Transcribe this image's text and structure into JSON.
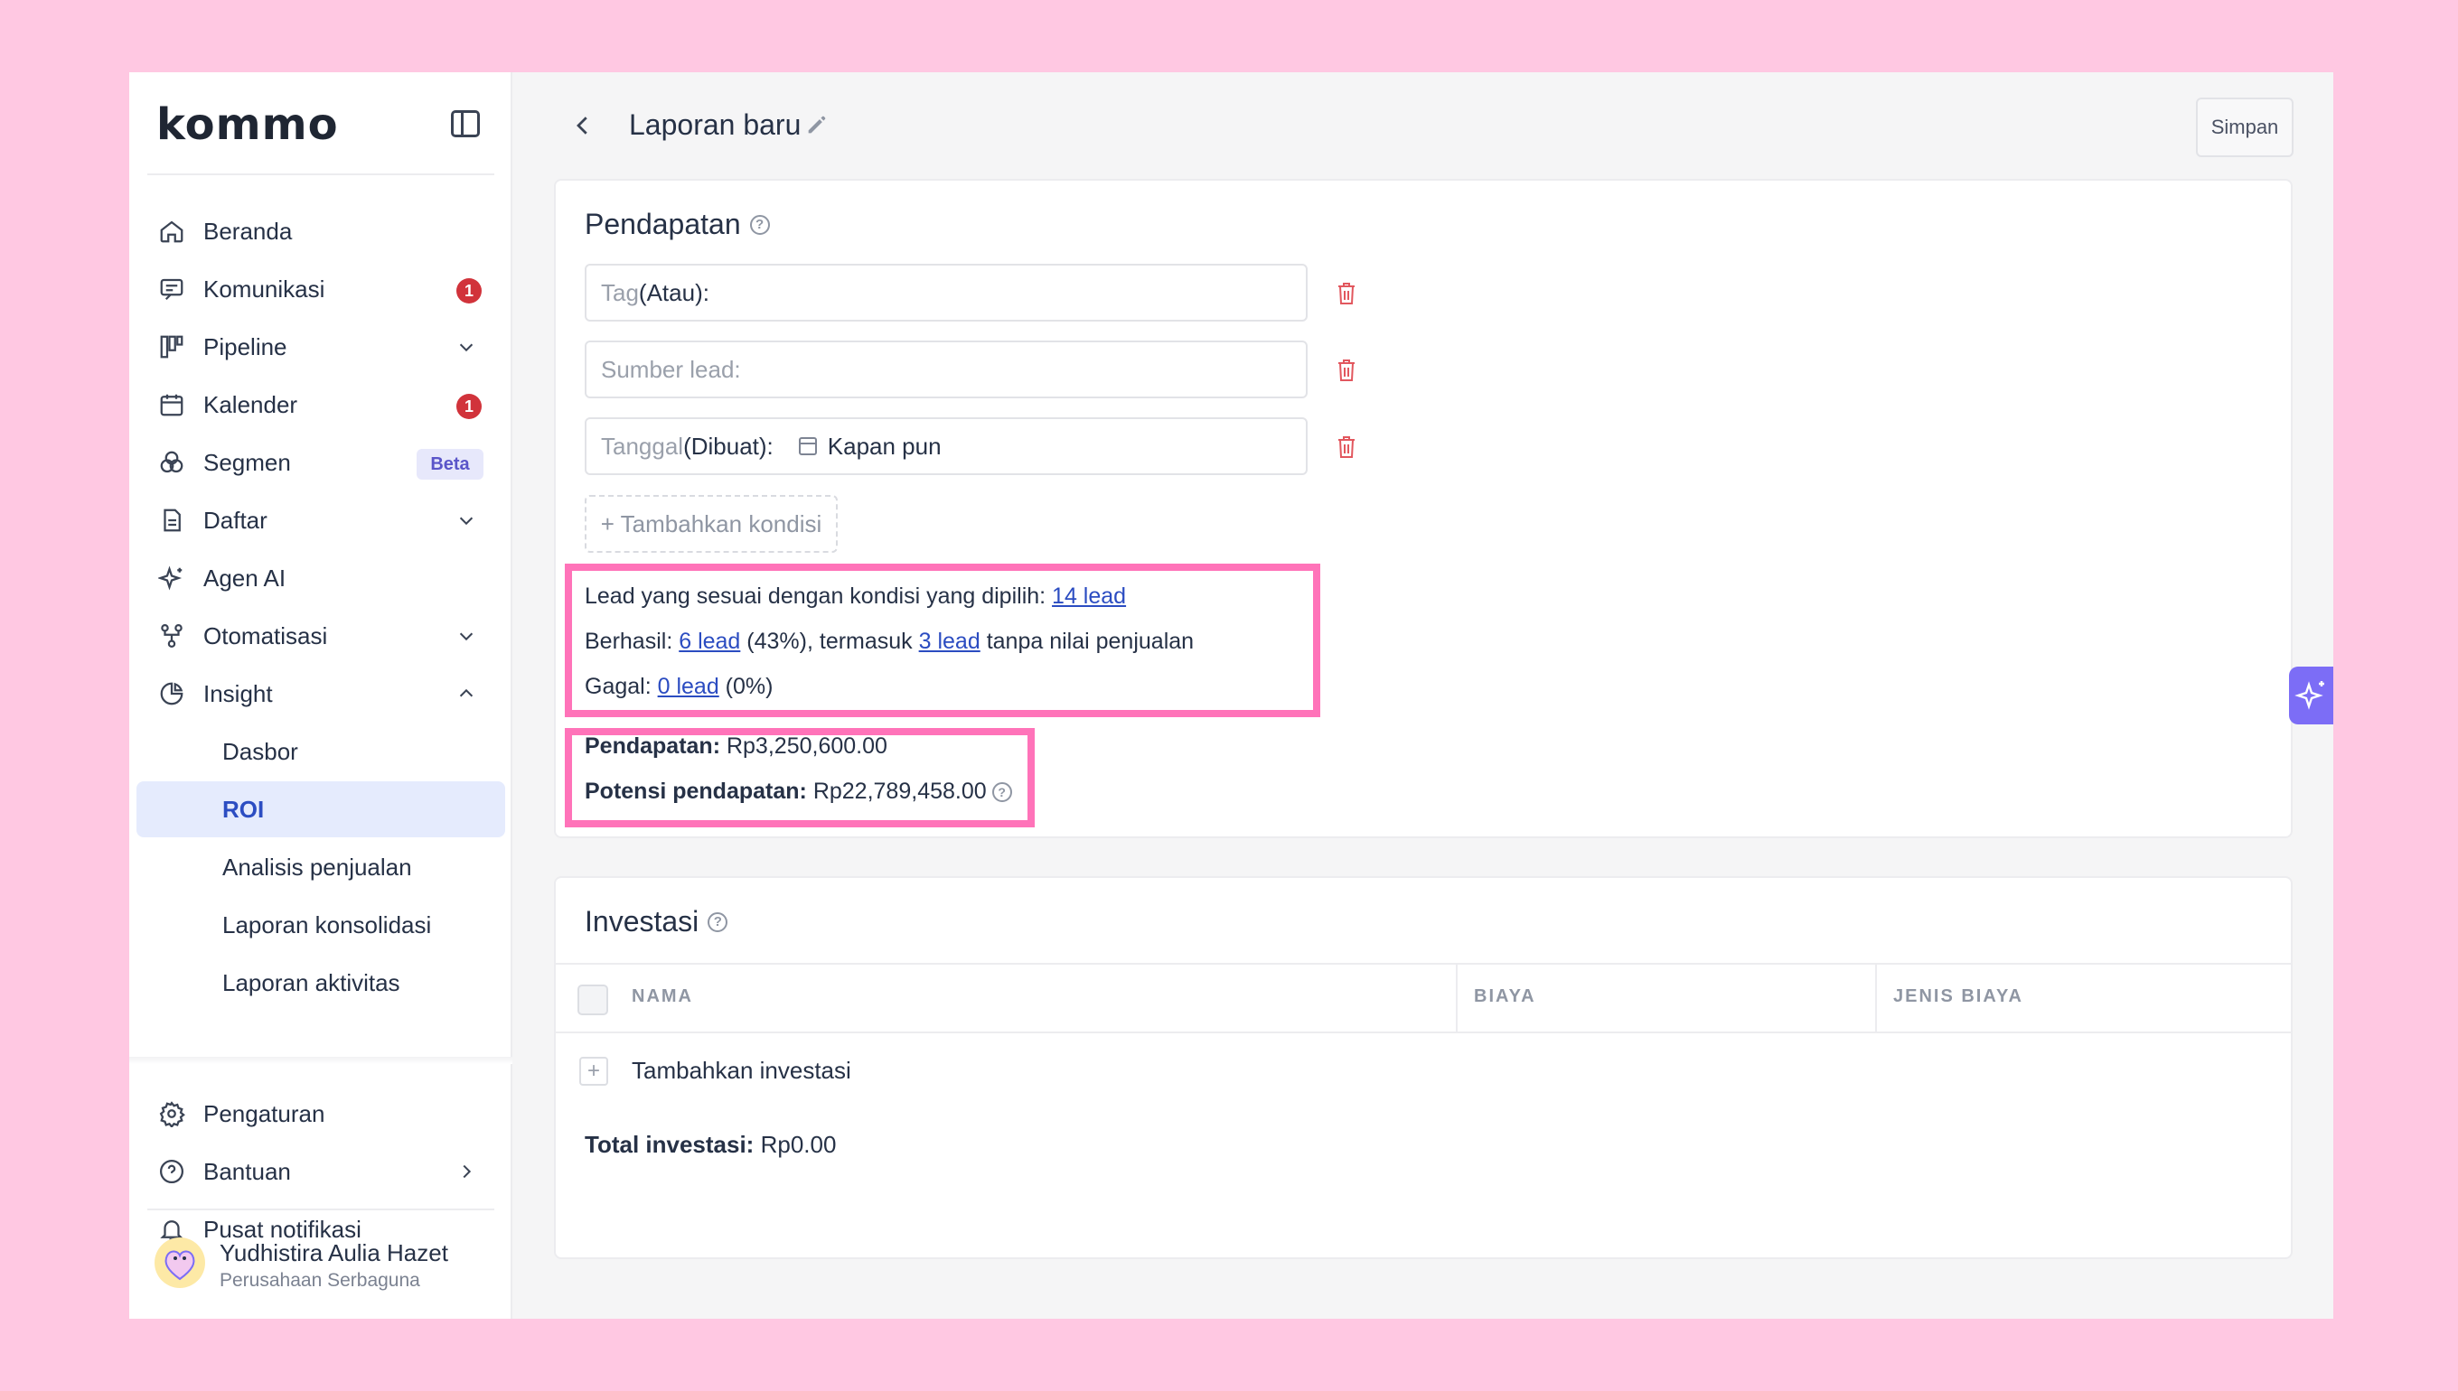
{
  "brand": {
    "logo_text": "kommo"
  },
  "sidebar": {
    "items": [
      {
        "label": "Beranda",
        "icon": "home-icon"
      },
      {
        "label": "Komunikasi",
        "icon": "chat-icon",
        "badge": "1"
      },
      {
        "label": "Pipeline",
        "icon": "pipeline-icon"
      },
      {
        "label": "Kalender",
        "icon": "calendar-icon",
        "badge": "1"
      },
      {
        "label": "Segmen",
        "icon": "segment-icon",
        "tag": "Beta"
      },
      {
        "label": "Daftar",
        "icon": "list-icon"
      },
      {
        "label": "Agen AI",
        "icon": "sparkle-icon"
      },
      {
        "label": "Otomatisasi",
        "icon": "automation-icon"
      },
      {
        "label": "Insight",
        "icon": "pie-chart-icon"
      }
    ],
    "sub_items": [
      {
        "label": "Dasbor"
      },
      {
        "label": "ROI",
        "active": true
      },
      {
        "label": "Analisis penjualan"
      },
      {
        "label": "Laporan konsolidasi"
      },
      {
        "label": "Laporan aktivitas"
      }
    ],
    "bottom_items": [
      {
        "label": "Pengaturan",
        "icon": "gear-icon"
      },
      {
        "label": "Bantuan",
        "icon": "help-icon"
      },
      {
        "label": "Pusat notifikasi",
        "icon": "bell-icon"
      }
    ],
    "user": {
      "name": "Yudhistira Aulia Hazet",
      "company": "Perusahaan Serbaguna"
    }
  },
  "header": {
    "title": "Laporan baru",
    "save_label": "Simpan"
  },
  "revenue": {
    "title": "Pendapatan",
    "filters": [
      {
        "placeholder": "Tag",
        "qualifier": " (Atau):",
        "value": ""
      },
      {
        "placeholder": "Sumber lead:",
        "qualifier": "",
        "value": ""
      },
      {
        "placeholder": "Tanggal",
        "qualifier": " (Dibuat):",
        "value": "Kapan pun"
      }
    ],
    "add_condition": "+ Tambahkan kondisi",
    "stats": {
      "matching_prefix": "Lead yang sesuai dengan kondisi yang dipilih: ",
      "matching_link": "14 lead",
      "success_prefix": "Berhasil: ",
      "success_link": "6 lead",
      "success_mid": " (43%), termasuk ",
      "success_link2": "3 lead",
      "success_suffix": " tanpa nilai penjualan",
      "failed_prefix": "Gagal: ",
      "failed_link": "0 lead",
      "failed_suffix": " (0%)"
    },
    "totals": {
      "revenue_label": "Pendapatan:",
      "revenue_value": " Rp3,250,600.00",
      "potential_label": "Potensi pendapatan:",
      "potential_value": " Rp22,789,458.00"
    }
  },
  "investment": {
    "title": "Investasi",
    "columns": [
      "NAMA",
      "BIAYA",
      "JENIS BIAYA"
    ],
    "add_label": "Tambahkan investasi",
    "total_label": "Total investasi:",
    "total_value": " Rp0.00"
  },
  "colors": {
    "accent": "#2c4dc2",
    "highlight": "#ff73b9",
    "badge": "#d1333b",
    "ai": "#7c6df6"
  }
}
